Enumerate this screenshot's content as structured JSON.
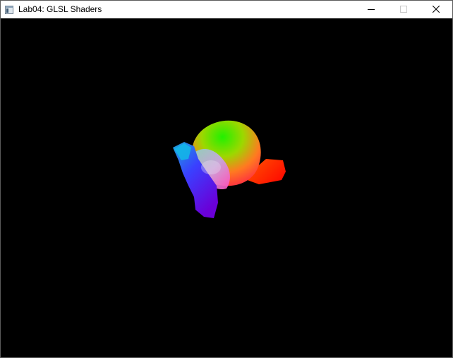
{
  "window": {
    "title": "Lab04: GLSL Shaders",
    "icon": "app-window-icon",
    "controls": {
      "minimize": "minimize-icon",
      "maximize": "maximize-icon",
      "close": "close-icon"
    }
  },
  "viewport": {
    "background": "#000000",
    "content": "shaded-monkey-head-model"
  },
  "colors": {
    "titlebar": "#ffffff",
    "title_text": "#000000",
    "viewport": "#000000"
  }
}
